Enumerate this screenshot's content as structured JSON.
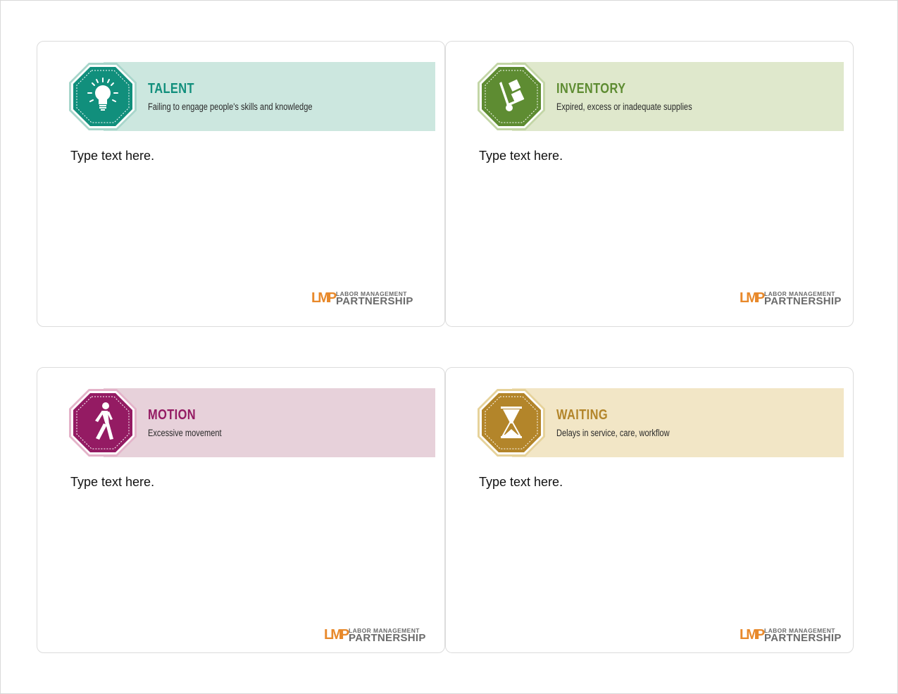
{
  "cards": [
    {
      "title": "TALENT",
      "subtitle": "Failing to engage people's skills and knowledge",
      "body": "Type text here.",
      "icon": "lightbulb-icon",
      "colors": {
        "accent": "#118f7c",
        "band": "#cce7df",
        "outer": "#a8d6cb"
      }
    },
    {
      "title": "INVENTORY",
      "subtitle": "Expired, excess or inadequate supplies",
      "body": "Type text here.",
      "icon": "hand-truck-icon",
      "colors": {
        "accent": "#5e8c32",
        "band": "#dfe8cc",
        "outer": "#c3d6a6"
      }
    },
    {
      "title": "MOTION",
      "subtitle": "Excessive movement",
      "body": "Type text here.",
      "icon": "walking-person-icon",
      "colors": {
        "accent": "#941b63",
        "band": "#e7d1da",
        "outer": "#e4b3c9"
      }
    },
    {
      "title": "WAITING",
      "subtitle": "Delays in service, care, workflow",
      "body": "Type text here.",
      "icon": "hourglass-icon",
      "colors": {
        "accent": "#b3852a",
        "band": "#f2e6c6",
        "outer": "#e6d29a"
      }
    }
  ],
  "logo": {
    "mark": "LMP",
    "line1": "LABOR MANAGEMENT",
    "line2": "PARTNERSHIP",
    "color": "#e8892b"
  }
}
